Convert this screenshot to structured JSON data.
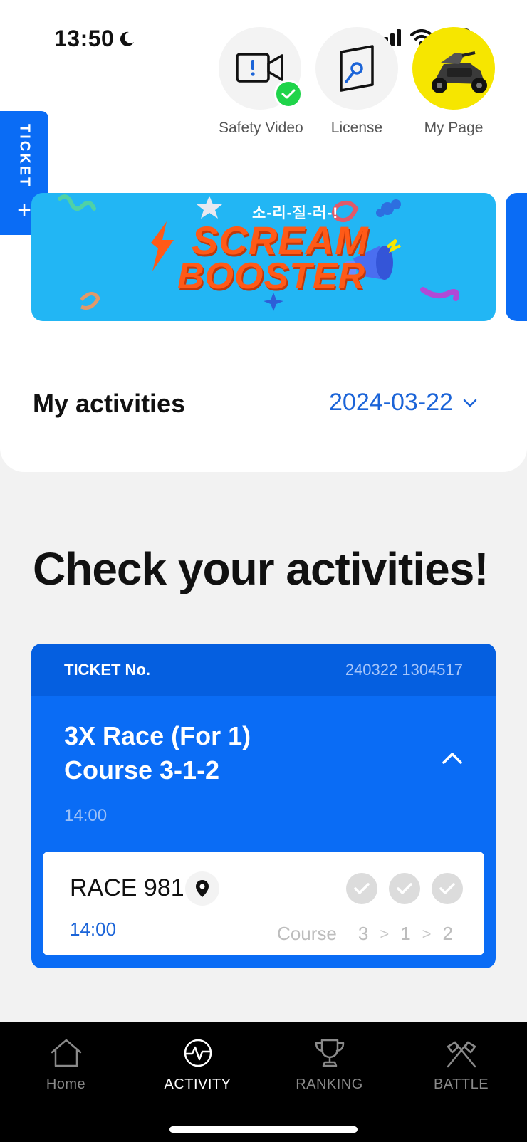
{
  "status": {
    "time": "13:50"
  },
  "quick_links": [
    {
      "label": "Safety Video",
      "icon": "video-alert-icon",
      "checked": true
    },
    {
      "label": "License",
      "icon": "license-card-icon"
    },
    {
      "label": "My Page",
      "icon": "kart-avatar"
    }
  ],
  "ticket_tab": {
    "label": "TICKET",
    "plus": "+"
  },
  "banner": {
    "korean_text": "소-리-질-러-!",
    "title_line1": "SCREAM",
    "title_line2": "BOOSTER"
  },
  "activities": {
    "heading": "My activities",
    "date": "2024-03-22"
  },
  "check_title": "Check your activities!",
  "ticket": {
    "label": "TICKET No.",
    "number": "240322 1304517",
    "race_title_line1": "3X Race (For 1)",
    "race_title_line2": "Course 3-1-2",
    "time": "14:00",
    "race": {
      "name": "RACE 981",
      "time": "14:00",
      "course_label": "Course",
      "course_steps": [
        "3",
        "1",
        "2"
      ],
      "sep": ">"
    }
  },
  "nav": [
    {
      "label": "Home",
      "icon": "home-icon",
      "active": false
    },
    {
      "label": "ACTIVITY",
      "icon": "activity-icon",
      "active": true
    },
    {
      "label": "RANKING",
      "icon": "trophy-icon",
      "active": false
    },
    {
      "label": "BATTLE",
      "icon": "crossed-flags-icon",
      "active": false
    }
  ],
  "colors": {
    "primary": "#0a6cf5",
    "banner_bg": "#22b6f4",
    "accent_text": "#1b64d8",
    "check_green": "#1fd44a"
  }
}
